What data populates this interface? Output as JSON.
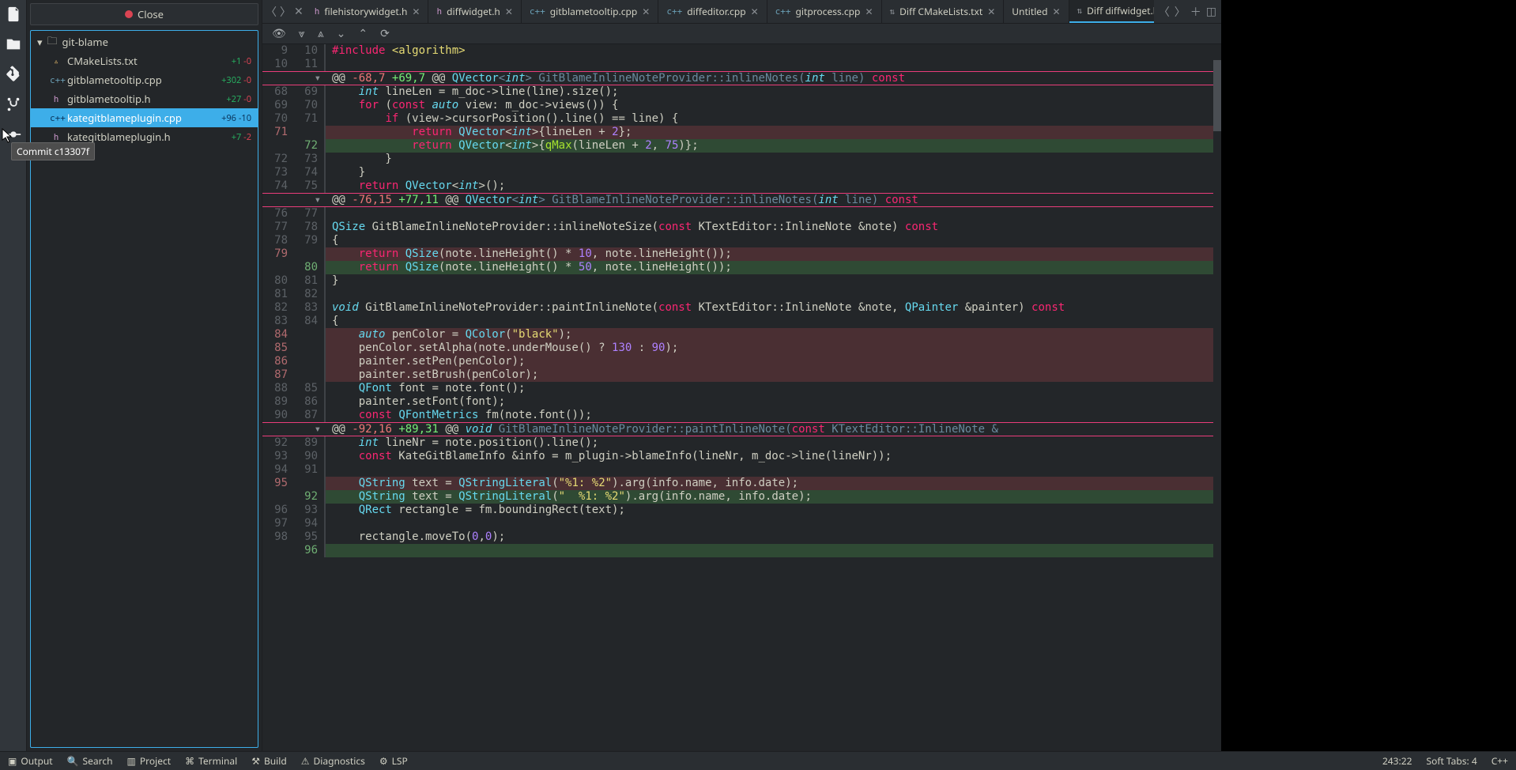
{
  "sidebar": {
    "close_label": "Close",
    "root_folder": "git-blame",
    "files": [
      {
        "icon": "txt",
        "iconGlyph": "▵",
        "name": "CMakeLists.txt",
        "plus": "+1",
        "minus": "-0"
      },
      {
        "icon": "cpp",
        "iconGlyph": "c++",
        "name": "gitblametooltip.cpp",
        "plus": "+302",
        "minus": "-0"
      },
      {
        "icon": "h",
        "iconGlyph": "h",
        "name": "gitblametooltip.h",
        "plus": "+27",
        "minus": "-0"
      },
      {
        "icon": "cpp",
        "iconGlyph": "c++",
        "name": "kategitblameplugin.cpp",
        "plus": "+96",
        "minus": "-10",
        "selected": true
      },
      {
        "icon": "h",
        "iconGlyph": "h",
        "name": "kategitblameplugin.h",
        "plus": "+7",
        "minus": "-2"
      }
    ],
    "tooltip": "Commit c13307f"
  },
  "tabs": {
    "items": [
      {
        "iconClass": "icon-h",
        "iconGlyph": "h",
        "label": "filehistorywidget.h",
        "closable": true
      },
      {
        "iconClass": "icon-h",
        "iconGlyph": "h",
        "label": "diffwidget.h",
        "closable": true
      },
      {
        "iconClass": "icon-cpp",
        "iconGlyph": "c++",
        "label": "gitblametooltip.cpp",
        "closable": true
      },
      {
        "iconClass": "icon-cpp",
        "iconGlyph": "c++",
        "label": "diffeditor.cpp",
        "closable": true
      },
      {
        "iconClass": "icon-cpp",
        "iconGlyph": "c++",
        "label": "gitprocess.cpp",
        "closable": true
      },
      {
        "iconClass": "diff-icon",
        "iconGlyph": "⇅",
        "label": "Diff CMakeLists.txt",
        "closable": true
      },
      {
        "iconClass": "",
        "iconGlyph": "",
        "label": "Untitled",
        "closable": true
      },
      {
        "iconClass": "diff-icon",
        "iconGlyph": "⇅",
        "label": "Diff diffwidget.h",
        "closable": true,
        "active": true
      }
    ]
  },
  "diff": {
    "rows": [
      {
        "kind": "code",
        "type": "unchanged",
        "l": "9",
        "r": "10",
        "html": "<span class='tk-preproc'>#include</span> <span class='tk-str'>&lt;algorithm&gt;</span>"
      },
      {
        "kind": "code",
        "type": "unchanged",
        "l": "10",
        "r": "11",
        "html": ""
      },
      {
        "kind": "hunk",
        "html": "<span class='tk-punct'>@@</span> <span class='tk-hunk-neg'>-68,7</span> <span class='tk-hunk-pos'>+69,7</span> <span class='tk-punct'>@@</span> <span class='tk-type2'>QVector</span>&lt;<span class='tk-type'>int</span>&gt; GitBlameInlineNoteProvider::inlineNotes(<span class='tk-type'>int</span> line) <span class='tk-keyword2'>const</span>"
      },
      {
        "kind": "code",
        "type": "unchanged",
        "l": "68",
        "r": "69",
        "html": "    <span class='tk-type'>int</span> lineLen = m_doc-&gt;line(line).size();"
      },
      {
        "kind": "code",
        "type": "unchanged",
        "l": "69",
        "r": "70",
        "html": "    <span class='tk-keyword2'>for</span> (<span class='tk-keyword2'>const</span> <span class='tk-type'>auto</span> view: m_doc-&gt;views()) {"
      },
      {
        "kind": "code",
        "type": "unchanged",
        "l": "70",
        "r": "71",
        "html": "        <span class='tk-keyword2'>if</span> (view-&gt;cursorPosition().line() == line) {"
      },
      {
        "kind": "code",
        "type": "removed",
        "l": "71",
        "r": "",
        "html": "            <span class='tk-keyword2'>return</span> <span class='tk-type2'>QVector</span>&lt;<span class='tk-type'>int</span>&gt;{lineLen + <span class='tk-num'>2</span>};"
      },
      {
        "kind": "code",
        "type": "added",
        "l": "",
        "r": "72",
        "html": "            <span class='tk-keyword2'>return</span> <span class='tk-type2'>QVector</span>&lt;<span class='tk-type'>int</span>&gt;{<span class='tk-fn'>qMax</span>(lineLen + <span class='tk-num'>2</span>, <span class='tk-num'>75</span>)};"
      },
      {
        "kind": "code",
        "type": "unchanged",
        "l": "72",
        "r": "73",
        "html": "        }"
      },
      {
        "kind": "code",
        "type": "unchanged",
        "l": "73",
        "r": "74",
        "html": "    }"
      },
      {
        "kind": "code",
        "type": "unchanged",
        "l": "74",
        "r": "75",
        "html": "    <span class='tk-keyword2'>return</span> <span class='tk-type2'>QVector</span>&lt;<span class='tk-type'>int</span>&gt;();"
      },
      {
        "kind": "hunk",
        "html": "<span class='tk-punct'>@@</span> <span class='tk-hunk-neg'>-76,15</span> <span class='tk-hunk-pos'>+77,11</span> <span class='tk-punct'>@@</span> <span class='tk-type2'>QVector</span>&lt;<span class='tk-type'>int</span>&gt; GitBlameInlineNoteProvider::inlineNotes(<span class='tk-type'>int</span> line) <span class='tk-keyword2'>const</span>"
      },
      {
        "kind": "code",
        "type": "unchanged",
        "l": "76",
        "r": "77",
        "html": ""
      },
      {
        "kind": "code",
        "type": "unchanged",
        "l": "77",
        "r": "78",
        "html": "<span class='tk-type2'>QSize</span> GitBlameInlineNoteProvider::inlineNoteSize(<span class='tk-keyword2'>const</span> KTextEditor::InlineNote &amp;note) <span class='tk-keyword2'>const</span>"
      },
      {
        "kind": "code",
        "type": "unchanged",
        "l": "78",
        "r": "79",
        "html": "{"
      },
      {
        "kind": "code",
        "type": "removed",
        "l": "79",
        "r": "",
        "html": "    <span class='tk-keyword2'>return</span> <span class='tk-type2'>QSize</span>(note.lineHeight() * <span class='tk-num'>10</span>, note.lineHeight());"
      },
      {
        "kind": "code",
        "type": "added",
        "l": "",
        "r": "80",
        "html": "    <span class='tk-keyword2'>return</span> <span class='tk-type2'>QSize</span>(note.lineHeight() * <span class='tk-num'>50</span>, note.lineHeight());"
      },
      {
        "kind": "code",
        "type": "unchanged",
        "l": "80",
        "r": "81",
        "html": "}"
      },
      {
        "kind": "code",
        "type": "unchanged",
        "l": "81",
        "r": "82",
        "html": ""
      },
      {
        "kind": "code",
        "type": "unchanged",
        "l": "82",
        "r": "83",
        "html": "<span class='tk-type'>void</span> GitBlameInlineNoteProvider::paintInlineNote(<span class='tk-keyword2'>const</span> KTextEditor::InlineNote &amp;note, <span class='tk-type2'>QPainter</span> &amp;painter) <span class='tk-keyword2'>const</span>"
      },
      {
        "kind": "code",
        "type": "unchanged",
        "l": "83",
        "r": "84",
        "html": "{"
      },
      {
        "kind": "code",
        "type": "removed",
        "l": "84",
        "r": "",
        "shade": true,
        "html": "    <span class='tk-type'>auto</span> penColor = <span class='tk-type2'>QColor</span>(<span class='tk-str'>\"black\"</span>);"
      },
      {
        "kind": "code",
        "type": "removed",
        "l": "85",
        "r": "",
        "shade": true,
        "html": "    penColor.setAlpha(note.underMouse() ? <span class='tk-num'>130</span> : <span class='tk-num'>90</span>);"
      },
      {
        "kind": "code",
        "type": "removed",
        "l": "86",
        "r": "",
        "shade": true,
        "html": "    painter.setPen(penColor);"
      },
      {
        "kind": "code",
        "type": "removed",
        "l": "87",
        "r": "",
        "shade": true,
        "html": "    painter.setBrush(penColor);"
      },
      {
        "kind": "code",
        "type": "unchanged",
        "l": "88",
        "r": "85",
        "html": "    <span class='tk-type2'>QFont</span> font = note.font();"
      },
      {
        "kind": "code",
        "type": "unchanged",
        "l": "89",
        "r": "86",
        "html": "    painter.setFont(font);"
      },
      {
        "kind": "code",
        "type": "unchanged",
        "l": "90",
        "r": "87",
        "html": "    <span class='tk-keyword2'>const</span> <span class='tk-type2'>QFontMetrics</span> fm(note.font());"
      },
      {
        "kind": "hunk",
        "html": "<span class='tk-punct'>@@</span> <span class='tk-hunk-neg'>-92,16</span> <span class='tk-hunk-pos'>+89,31</span> <span class='tk-punct'>@@</span> <span class='tk-type'>void</span> GitBlameInlineNoteProvider::paintInlineNote(<span class='tk-keyword2'>const</span> KTextEditor::InlineNote &amp;"
      },
      {
        "kind": "code",
        "type": "unchanged",
        "l": "92",
        "r": "89",
        "html": "    <span class='tk-type'>int</span> lineNr = note.position().line();"
      },
      {
        "kind": "code",
        "type": "unchanged",
        "l": "93",
        "r": "90",
        "html": "    <span class='tk-keyword2'>const</span> KateGitBlameInfo &amp;info = m_plugin-&gt;blameInfo(lineNr, m_doc-&gt;line(lineNr));"
      },
      {
        "kind": "code",
        "type": "unchanged",
        "l": "94",
        "r": "91",
        "html": ""
      },
      {
        "kind": "code",
        "type": "removed",
        "l": "95",
        "r": "",
        "html": "    <span class='tk-type2'>QString</span> text = <span class='tk-type2'>QStringLiteral</span>(<span class='tk-str'>\"%1: %2\"</span>).arg(info.name, info.date);"
      },
      {
        "kind": "code",
        "type": "added",
        "l": "",
        "r": "92",
        "html": "    <span class='tk-type2'>QString</span> text = <span class='tk-type2'>QStringLiteral</span>(<span class='tk-str'>\"  %1: %2\"</span>).arg(info.name, info.date);"
      },
      {
        "kind": "code",
        "type": "unchanged",
        "l": "96",
        "r": "93",
        "html": "    <span class='tk-type2'>QRect</span> rectangle = fm.boundingRect(text);"
      },
      {
        "kind": "code",
        "type": "unchanged",
        "l": "97",
        "r": "94",
        "html": ""
      },
      {
        "kind": "code",
        "type": "unchanged",
        "l": "98",
        "r": "95",
        "html": "    rectangle.moveTo(<span class='tk-num'>0</span>,<span class='tk-num'>0</span>);"
      },
      {
        "kind": "code",
        "type": "added",
        "l": "",
        "r": "96",
        "html": ""
      }
    ]
  },
  "status": {
    "output": "Output",
    "search": "Search",
    "project": "Project",
    "terminal": "Terminal",
    "build": "Build",
    "diagnostics": "Diagnostics",
    "lsp": "LSP",
    "pos": "243:22",
    "indent": "Soft Tabs: 4",
    "lang": "C++"
  }
}
